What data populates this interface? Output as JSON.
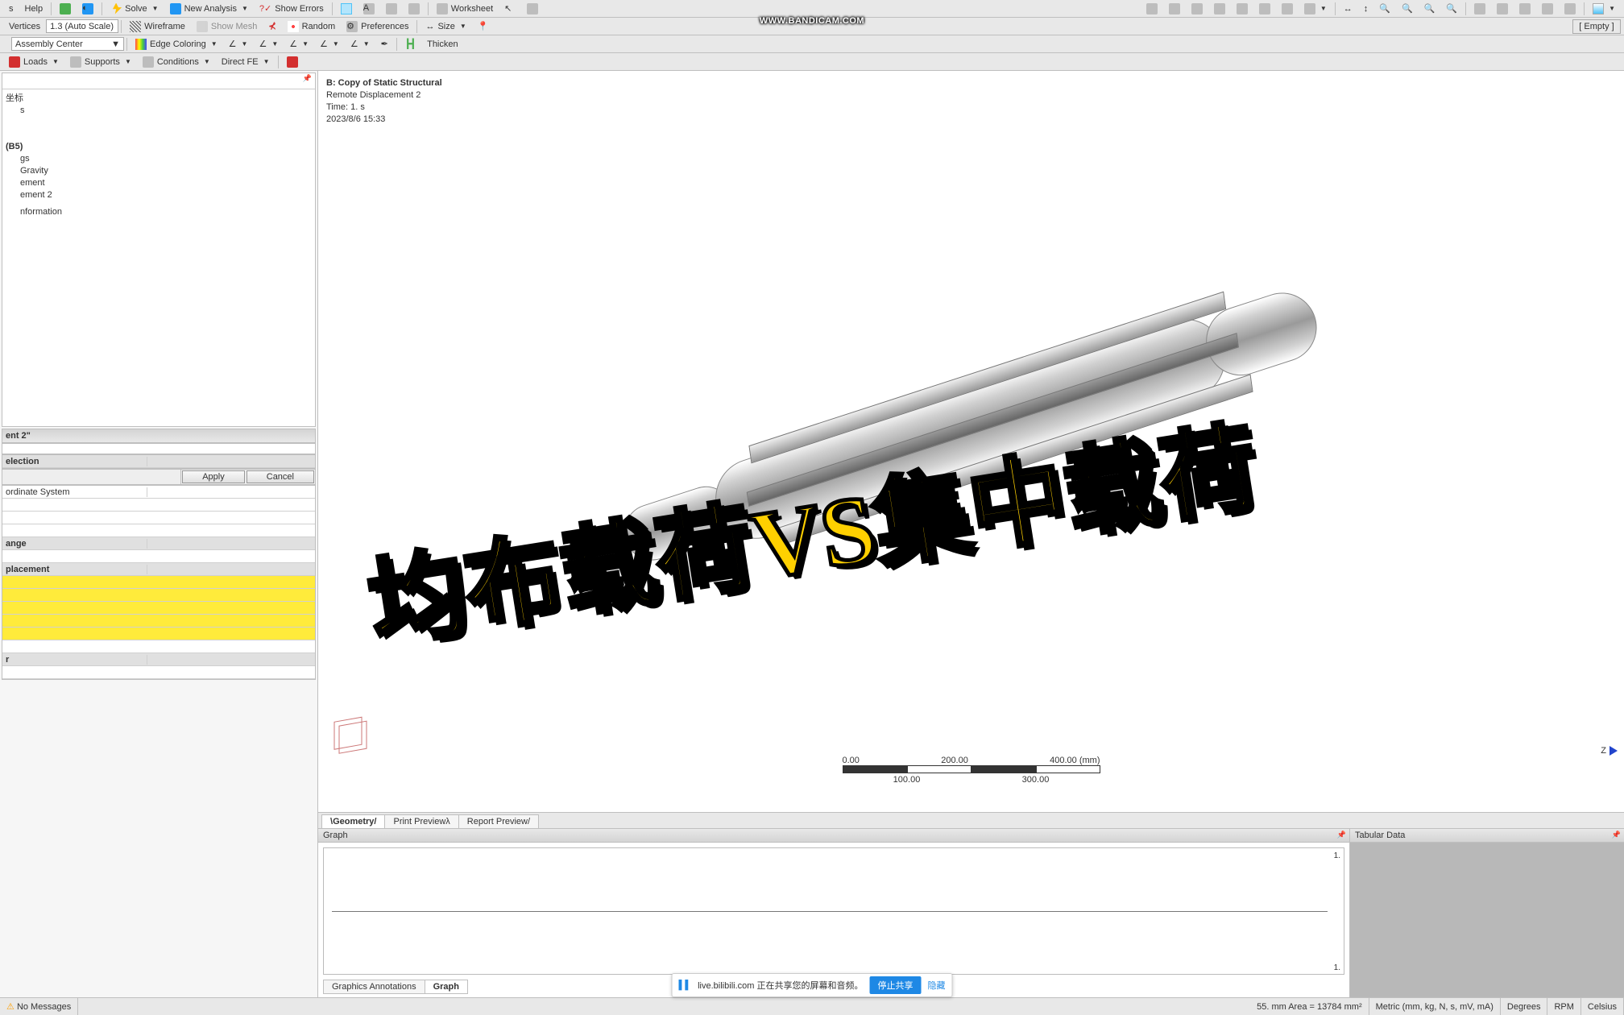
{
  "menu": {
    "help": "Help"
  },
  "toolbar1": {
    "solve": "Solve",
    "new_analysis": "New Analysis",
    "show_errors": "Show Errors",
    "worksheet": "Worksheet",
    "empty": "[ Empty ]"
  },
  "toolbar2": {
    "vertices": "Vertices",
    "autoscale": "1.3 (Auto Scale)",
    "wireframe": "Wireframe",
    "show_mesh": "Show Mesh",
    "random": "Random",
    "preferences": "Preferences",
    "size": "Size"
  },
  "toolbar3": {
    "assembly_center": "Assembly Center",
    "edge_coloring": "Edge Coloring",
    "thicken": "Thicken"
  },
  "toolbar4": {
    "loads": "Loads",
    "supports": "Supports",
    "conditions": "Conditions",
    "direct_fe": "Direct FE"
  },
  "tree": {
    "n0": "坐标",
    "n1": "s",
    "n2": "(B5)",
    "n3": "gs",
    "n4": "Gravity",
    "n5": "ement",
    "n6": "ement 2",
    "n7": "nformation"
  },
  "details": {
    "title": "ent 2\"",
    "selection_header": "election",
    "apply": "Apply",
    "cancel": "Cancel",
    "coord_sys": "ordinate System",
    "range": "ange",
    "placement": "placement"
  },
  "viewport": {
    "title": "B: Copy of Static Structural",
    "subtitle": "Remote Displacement 2",
    "time": "Time: 1. s",
    "date": "2023/8/6 15:33",
    "axis": "Z",
    "scale": {
      "s0": "0.00",
      "s1": "200.00",
      "s2": "400.00 (mm)",
      "m1": "100.00",
      "m2": "300.00"
    }
  },
  "vp_tabs": {
    "geometry": "Geometry",
    "print_preview": "Print Preview",
    "report_preview": "Report Preview"
  },
  "graph": {
    "title": "Graph",
    "top": "1.",
    "bot": "1.",
    "annotations": "Graphics Annotations",
    "graph_tab": "Graph"
  },
  "tabular": {
    "title": "Tabular Data"
  },
  "status": {
    "no_msgs": "No Messages",
    "sel": "55. mm  Area = 13784 mm²",
    "units": "Metric (mm, kg, N, s, mV, mA)",
    "deg": "Degrees",
    "rpm": "RPM",
    "cels": "Celsius"
  },
  "overlay": "均布载荷VS集中载荷",
  "watermark": "WWW.BANDICAM.COM",
  "share": {
    "text": "live.bilibili.com 正在共享您的屏幕和音频。",
    "stop": "停止共享",
    "hide": "隐藏"
  }
}
